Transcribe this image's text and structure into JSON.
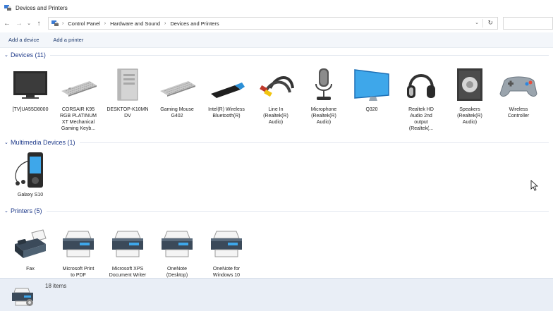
{
  "window": {
    "title": "Devices and Printers"
  },
  "breadcrumb": [
    "Control Panel",
    "Hardware and Sound",
    "Devices and Printers"
  ],
  "commands": {
    "add_device": "Add a device",
    "add_printer": "Add a printer"
  },
  "groups": {
    "devices": {
      "title": "Devices (11)",
      "items": [
        {
          "label": "[TV]UA55D8000",
          "icon": "tv-icon"
        },
        {
          "label": "CORSAIR K95\nRGB PLATINUM\nXT Mechanical\nGaming Keyb...",
          "icon": "keyboard-icon"
        },
        {
          "label": "DESKTOP-K10MN\nDV",
          "icon": "desktop-tower-icon"
        },
        {
          "label": "Gaming Mouse\nG402",
          "icon": "keyboard-icon"
        },
        {
          "label": "Intel(R) Wireless\nBluetooth(R)",
          "icon": "bluetooth-dongle-icon"
        },
        {
          "label": "Line In\n(Realtek(R)\nAudio)",
          "icon": "rca-cable-icon"
        },
        {
          "label": "Microphone\n(Realtek(R)\nAudio)",
          "icon": "microphone-icon"
        },
        {
          "label": "Q320",
          "icon": "monitor-icon"
        },
        {
          "label": "Realtek HD\nAudio 2nd\noutput\n(Realtek(...",
          "icon": "headphones-icon"
        },
        {
          "label": "Speakers\n(Realtek(R)\nAudio)",
          "icon": "speaker-icon"
        },
        {
          "label": "Wireless\nController",
          "icon": "gamepad-icon"
        }
      ]
    },
    "multimedia": {
      "title": "Multimedia Devices (1)",
      "items": [
        {
          "label": "Galaxy S10",
          "icon": "media-player-icon"
        }
      ]
    },
    "printers": {
      "title": "Printers (5)",
      "items": [
        {
          "label": "Fax",
          "icon": "fax-icon"
        },
        {
          "label": "Microsoft Print\nto PDF",
          "icon": "printer-icon"
        },
        {
          "label": "Microsoft XPS\nDocument Writer",
          "icon": "printer-icon"
        },
        {
          "label": "OneNote\n(Desktop)",
          "icon": "printer-icon"
        },
        {
          "label": "OneNote for\nWindows 10",
          "icon": "printer-icon"
        }
      ]
    }
  },
  "status": {
    "count": "18 items"
  },
  "colors": {
    "accent": "#1e3a8a",
    "statusbar": "#e9eef6",
    "commandbar": "#f3f6fa"
  }
}
